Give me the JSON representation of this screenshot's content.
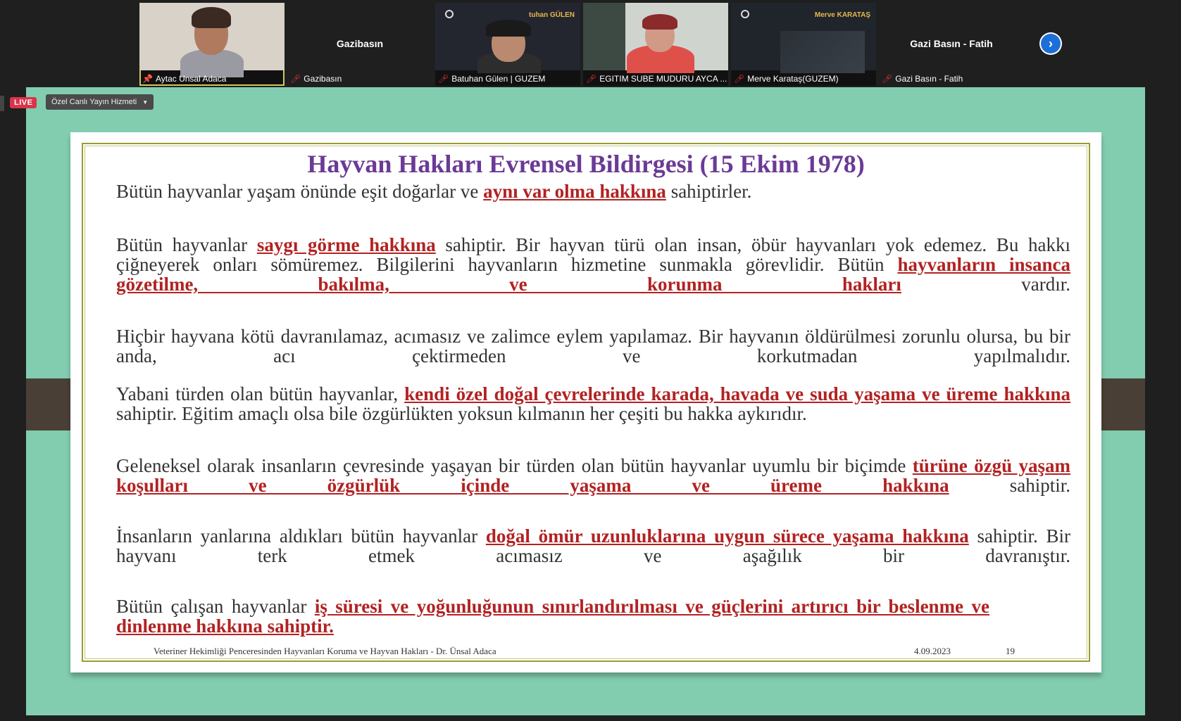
{
  "participants": [
    {
      "name": "Aytac Unsal Adaca",
      "pinned": true
    },
    {
      "name": "Gazibasın",
      "tile_label": "Gazibasın",
      "muted": true
    },
    {
      "name": "Batuhan Gülen | GUZEM",
      "overlay": "tuhan GÜLEN",
      "muted": true
    },
    {
      "name": "EGITIM SUBE MUDURU AYCA ...",
      "muted": true
    },
    {
      "name": "Merve Karataş(GUZEM)",
      "overlay": "Merve KARATAŞ",
      "muted": true
    },
    {
      "name": "Gazi Basın - Fatih",
      "tile_label": "Gazi Basın - Fatih",
      "muted": true
    }
  ],
  "live_bar": {
    "badge": "LIVE",
    "service": "Özel Canlı Yayın Hizmeti"
  },
  "slide": {
    "title": "Hayvan Hakları Evrensel Bildirgesi (15 Ekim 1978)",
    "p1": {
      "a": "Bütün hayvanlar yaşam önünde eşit doğarlar ve ",
      "hl": "aynı var olma hakkına",
      "b": " sahiptirler."
    },
    "p2": {
      "a": "Bütün hayvanlar ",
      "hl1": "saygı görme hakkına",
      "b": " sahiptir. Bir hayvan türü olan insan, öbür hayvanları yok edemez. Bu hakkı çiğneyerek onları sömüremez. Bilgilerini hayvanların hizmetine sunmakla görevlidir. Bütün ",
      "hl2": "hayvanların insanca gözetilme, bakılma, ve korunma hakları",
      "c": " vardır."
    },
    "p3": {
      "a": "Hiçbir hayvana kötü davranılamaz, acımasız ve zalimce eylem yapılamaz. Bir hayvanın öldürülmesi zorunlu olursa, bu bir anda, acı çektirmeden ve korkutmadan yapılmalıdır."
    },
    "p4": {
      "a": "Yabani türden olan bütün hayvanlar, ",
      "hl": "kendi özel doğal çevrelerinde karada, havada ve suda yaşama ve üreme hakkına",
      "b": " sahiptir. Eğitim amaçlı olsa bile özgürlükten yoksun kılmanın her çeşiti bu hakka aykırıdır."
    },
    "p5": {
      "a": "Geleneksel olarak insanların çevresinde yaşayan bir türden olan bütün hayvanlar uyumlu bir biçimde ",
      "hl": "türüne özgü yaşam koşulları ve özgürlük içinde yaşama ve üreme hakkına",
      "b": " sahiptir."
    },
    "p6": {
      "a": "İnsanların yanlarına aldıkları bütün hayvanlar ",
      "hl": "doğal ömür uzunluklarına uygun sürece yaşama hakkına",
      "b": " sahiptir. Bir hayvanı terk etmek acımasız ve aşağılık bir davranıştır."
    },
    "p7": {
      "a": "Bütün çalışan hayvanlar ",
      "hl": "iş süresi ve yoğunluğunun sınırlandırılması ve güçlerini artırıcı bir beslenme ve dinlenme  hakkına sahiptir."
    },
    "footer_text": "Veteriner Hekimliği Penceresinden Hayvanları Koruma ve Hayvan Hakları - Dr. Ünsal Adaca",
    "footer_date": "4.09.2023",
    "footer_page": "19"
  }
}
